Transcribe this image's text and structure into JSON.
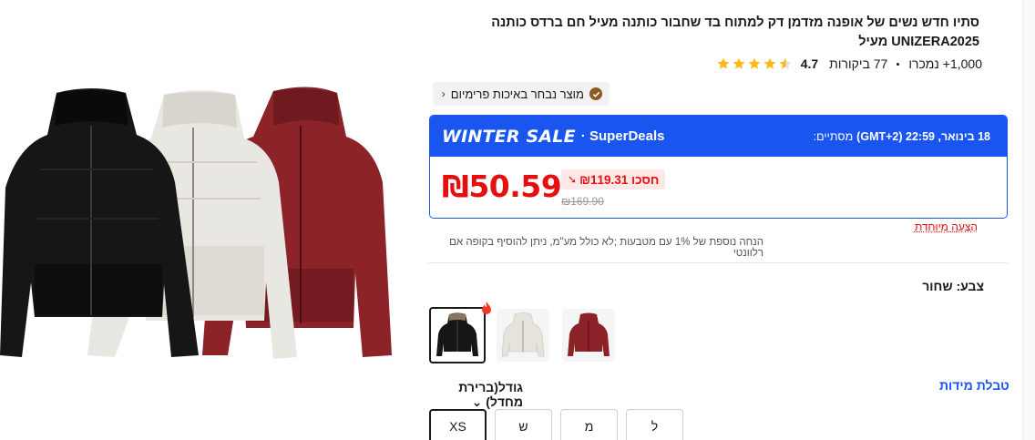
{
  "product": {
    "title": "סתיו חדש נשים של אופנה מזדמן דק למתוח בד שחבור כותנה מעיל חם ברדס כותנה UNIZERA2025 מעיל",
    "rating": "4.7",
    "reviews": "77 ביקורות",
    "sold": "1,000+ נמכרו",
    "stars": 4.5,
    "choice_badge": "מוצר נבחר באיכות פרימיום"
  },
  "deal": {
    "banner": "WINTER SALE",
    "program": "· SuperDeals",
    "ends_label": "מסתיים:",
    "ends_date": "18 בינואר, 22:59 (GMT+2)",
    "price": "₪50.59",
    "save": "חסכו ₪119.31",
    "original_price": "₪169.90",
    "banner_color": "#1a55f0",
    "price_color": "#e60f0f"
  },
  "offers": {
    "special": "הַצָּעָה מְיוּחֶדֶת",
    "bonus": "הנחה נוספת של 1% עם מטבעות ;לא כולל מע\"מ, ניתן להוסיף בקופה אם רלוונטי"
  },
  "color": {
    "label": "צבע: שחור",
    "options": [
      {
        "name": "שחור",
        "hex": "#151515",
        "selected": true
      },
      {
        "name": "לבן",
        "hex": "#eceae6",
        "selected": false
      },
      {
        "name": "בורדו",
        "hex": "#8a2228",
        "selected": false
      }
    ]
  },
  "size": {
    "label": "גודל(ברירת מחדל)",
    "chart_link": "טבלת מידות",
    "options": [
      "XS",
      "ש",
      "מ",
      "ל"
    ],
    "selected": "XS"
  },
  "icons": {
    "star": "star-icon",
    "choice": "checkmark-icon",
    "chevron": "chevron-left-icon",
    "down": "chevron-down-icon",
    "fire": "fire-icon"
  }
}
